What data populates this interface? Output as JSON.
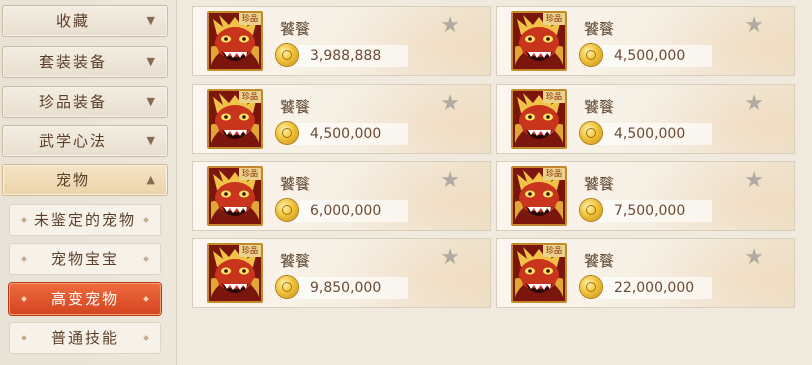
{
  "sidebar": {
    "categories": [
      {
        "label": "收藏",
        "arrow": "▼"
      },
      {
        "label": "套装装备",
        "arrow": "▼"
      },
      {
        "label": "珍品装备",
        "arrow": "▼"
      },
      {
        "label": "武学心法",
        "arrow": "▼"
      },
      {
        "label": "宠物",
        "arrow": "▲"
      }
    ],
    "subitems": [
      {
        "label": "未鉴定的宠物"
      },
      {
        "label": "宠物宝宝"
      },
      {
        "label": "高变宠物"
      },
      {
        "label": "普通技能"
      }
    ]
  },
  "listings": [
    {
      "tag": "珍品",
      "name": "饕餮",
      "price": "3,988,888"
    },
    {
      "tag": "珍品",
      "name": "饕餮",
      "price": "4,500,000"
    },
    {
      "tag": "珍品",
      "name": "饕餮",
      "price": "4,500,000"
    },
    {
      "tag": "珍品",
      "name": "饕餮",
      "price": "4,500,000"
    },
    {
      "tag": "珍品",
      "name": "饕餮",
      "price": "6,000,000"
    },
    {
      "tag": "珍品",
      "name": "饕餮",
      "price": "7,500,000"
    },
    {
      "tag": "珍品",
      "name": "饕餮",
      "price": "9,850,000"
    },
    {
      "tag": "珍品",
      "name": "饕餮",
      "price": "22,000,000"
    }
  ],
  "icons": {
    "star": "star-icon",
    "coin": "gold-coin-icon",
    "pet": "taotie-pet-icon"
  },
  "colors": {
    "accent": "#e05a30",
    "text": "#5c3f2a",
    "frame": "#c28a2c"
  }
}
